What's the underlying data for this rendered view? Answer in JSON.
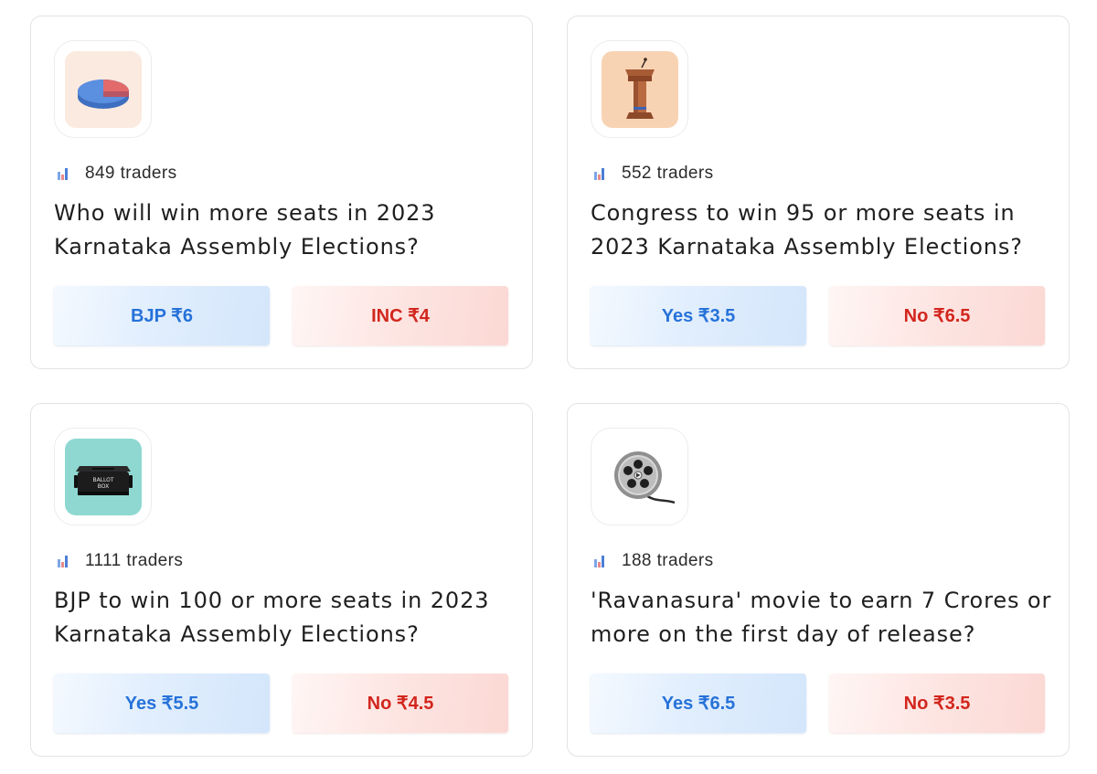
{
  "markets": [
    {
      "icon": "pie-chart-icon",
      "icon_bg": "#fbeadf",
      "traders": "849 traders",
      "question": "Who will win more seats in 2023 Karnataka Assembly Elections?",
      "yes_label": "BJP ₹6",
      "no_label": "INC ₹4"
    },
    {
      "icon": "podium-icon",
      "icon_bg": "#f8d3b3",
      "traders": "552 traders",
      "question": "Congress to win 95 or more seats in 2023 Karnataka Assembly Elections?",
      "yes_label": "Yes ₹3.5",
      "no_label": "No ₹6.5"
    },
    {
      "icon": "ballot-box-icon",
      "icon_bg": "#8fd8d2",
      "icon_text": [
        "BALLOT",
        "BOX"
      ],
      "traders": "1111 traders",
      "question": "BJP to win 100 or more seats in 2023 Karnataka Assembly Elections?",
      "yes_label": "Yes ₹5.5",
      "no_label": "No ₹4.5"
    },
    {
      "icon": "film-reel-icon",
      "icon_bg": "#ffffff",
      "traders": "188 traders",
      "question": "'Ravanasura' movie to earn 7 Crores or more on the first day of release?",
      "yes_label": "Yes ₹6.5",
      "no_label": "No ₹3.5"
    }
  ],
  "colors": {
    "yes_text": "#2672d9",
    "no_text": "#d2261d",
    "card_border": "#e3e3e3"
  }
}
